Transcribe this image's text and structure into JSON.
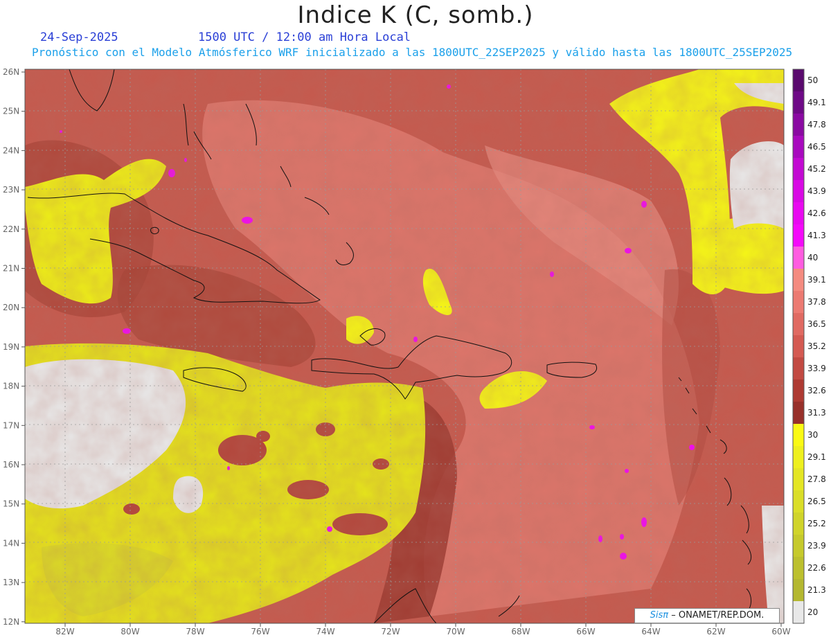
{
  "header": {
    "title": "Indice K (C, somb.)",
    "date": "24-Sep-2025",
    "time": "1500 UTC / 12:00 am Hora Local",
    "subtitle": "Pronóstico con el Modelo Atmósferico WRF inicializado a las 1800UTC_22SEP2025 y válido hasta las  1800UTC_25SEP2025"
  },
  "axes": {
    "lat_labels": [
      "26N",
      "25N",
      "24N",
      "23N",
      "22N",
      "21N",
      "20N",
      "19N",
      "18N",
      "17N",
      "16N",
      "15N",
      "14N",
      "13N",
      "12N"
    ],
    "lon_labels": [
      "82W",
      "80W",
      "78W",
      "76W",
      "74W",
      "72W",
      "70W",
      "68W",
      "66W",
      "64W",
      "62W",
      "60W"
    ]
  },
  "colorbar": {
    "labels": [
      "50",
      "49.1",
      "47.8",
      "46.5",
      "45.2",
      "43.9",
      "42.6",
      "41.3",
      "40",
      "39.1",
      "37.8",
      "36.5",
      "35.2",
      "33.9",
      "32.6",
      "31.3",
      "30",
      "29.1",
      "27.8",
      "26.5",
      "25.2",
      "23.9",
      "22.6",
      "21.3",
      "20"
    ],
    "colors": [
      "#5a0a6e",
      "#6e0a86",
      "#8a0aa2",
      "#a80abe",
      "#c20ad2",
      "#d80ae4",
      "#e80af0",
      "#f40afa",
      "#ff5ce0",
      "#f48b80",
      "#ec7a72",
      "#e06a62",
      "#d45a52",
      "#c24a42",
      "#ae3a32",
      "#98302a",
      "#fafa14",
      "#eef01e",
      "#e4e624",
      "#dade28",
      "#d0d42a",
      "#c6ca2c",
      "#bcc02e",
      "#b4b830",
      "#e8e8e8"
    ]
  },
  "credit": {
    "logo": "Sisπ",
    "text": "– ONAMET/REP.DOM."
  }
}
